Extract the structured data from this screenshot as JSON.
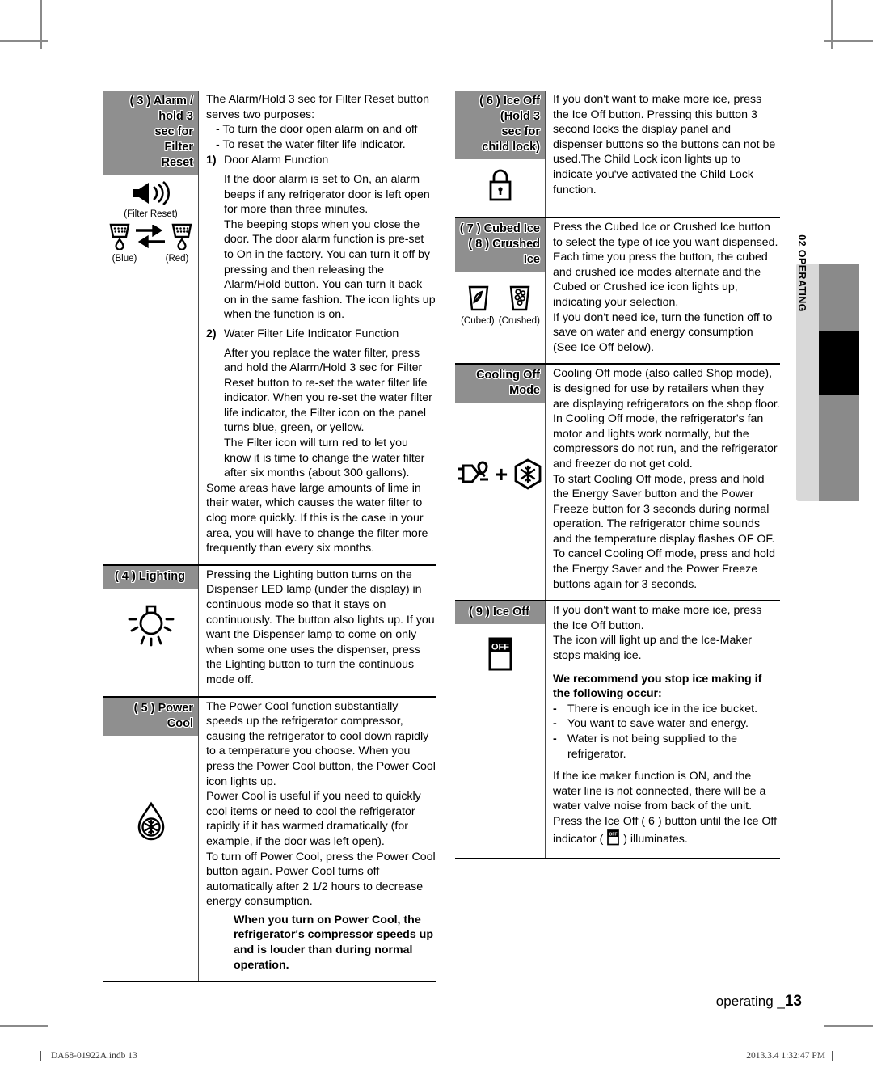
{
  "page": {
    "footer_label": "operating _",
    "page_number": "13",
    "indb_file": "DA68-01922A.indb   13",
    "print_stamp": "2013.3.4   1:32:47 PM",
    "side_tab_label": "02  OPERATING"
  },
  "colors": {
    "header_gray": "#8f8f8f",
    "side_tab_gray": "#d8d8d8",
    "side_bar_gray": "#8a8a8a",
    "side_bar_active": "#000000"
  },
  "left_column": {
    "sections": [
      {
        "id": "alarm-filter-reset",
        "title": "( 3 ) Alarm /\nhold 3\nsec for\nFilter\nReset",
        "icons": {
          "speaker_label": "(Filter Reset)",
          "blue_label": "(Blue)",
          "red_label": "(Red)"
        },
        "body": {
          "intro": "The Alarm/Hold 3 sec for Filter Reset button serves two purposes:",
          "dash1": "- To turn the door open alarm on and off",
          "dash2": "- To reset the water filter life indicator.",
          "item1_num": "1)",
          "item1_title": "Door Alarm Function",
          "item1_p1": "If the door alarm is set to On, an alarm beeps if any refrigerator door is left open for more than three minutes.",
          "item1_p2": "The beeping stops when you close the door. The door alarm function is pre-set to On in the factory. You can turn it off by pressing and then releasing the Alarm/Hold button. You can turn it back on in the same fashion. The icon lights up when the function is on.",
          "item2_num": "2)",
          "item2_title": "Water Filter Life Indicator Function",
          "item2_p1": "After you replace the water filter, press and hold the Alarm/Hold 3 sec for Filter Reset button to re-set the water filter life indicator. When you re-set the water filter life indicator, the Filter icon on the panel turns blue, green, or yellow.",
          "item2_p2": "The Filter icon will turn red to let you know it is time to change the water filter after six months (about 300 gallons).",
          "outro": "Some areas have large amounts of lime in their water, which causes the water filter to clog more quickly. If this is the case in your area, you will have to change the filter more frequently than every six months."
        }
      },
      {
        "id": "lighting",
        "title": "( 4 ) Lighting",
        "body": {
          "p1": "Pressing the Lighting button turns on the Dispenser LED lamp (under the display) in continuous mode so that it stays on continuously. The button also lights up. If you want the Dispenser lamp to come on only when some one uses the dispenser, press the Lighting button to turn the continuous mode off."
        }
      },
      {
        "id": "power-cool",
        "title": "( 5 ) Power\nCool",
        "body": {
          "p1": "The Power Cool function substantially speeds up the refrigerator compressor, causing the refrigerator to cool down rapidly to a temperature you choose. When you press the Power Cool button, the Power Cool icon lights up.",
          "p2": "Power Cool is useful if you need to quickly cool items or need to cool the refrigerator rapidly if it has warmed dramatically (for example, if the door was left open).",
          "p3": "To turn off Power Cool, press the Power Cool button again. Power Cool turns off automatically after 2 1/2 hours to decrease energy consumption.",
          "note": "When you turn on Power Cool, the refrigerator's compressor speeds up and is louder than during normal operation."
        }
      }
    ]
  },
  "right_column": {
    "sections": [
      {
        "id": "ice-off-child-lock",
        "title": "( 6 ) Ice Off\n(Hold 3\nsec for\nchild lock)",
        "body": {
          "p1": "If you don't want to make more ice, press the Ice Off button.  Pressing this button 3 second locks the display panel and dispenser buttons so the buttons can not be used.The Child Lock icon lights up to indicate you've activated the Child Lock function."
        }
      },
      {
        "id": "cubed-crushed-ice",
        "title": "( 7 ) Cubed Ice\n( 8 ) Crushed\nIce",
        "icons": {
          "cubed_label": "(Cubed)",
          "crushed_label": "(Crushed)"
        },
        "body": {
          "p1": "Press the Cubed Ice or Crushed Ice button to select the type of ice you want dispensed. Each time you press the button, the cubed and crushed ice modes alternate and the Cubed or Crushed ice icon lights up, indicating your selection.",
          "p2": "If you don't need ice, turn the function off to save on water and energy consumption (See Ice Off below)."
        }
      },
      {
        "id": "cooling-off-mode",
        "title": "Cooling Off\nMode",
        "body": {
          "p1": "Cooling Off mode (also called Shop mode), is designed for use by retailers when they are displaying refrigerators on the shop floor. In Cooling Off mode, the refrigerator's fan motor and lights work normally, but the compressors do not run, and the refrigerator and freezer do not get cold.",
          "p2": "To start Cooling Off mode, press and hold the Energy Saver button and the Power Freeze button for 3 seconds during normal operation. The refrigerator chime sounds and the temperature display flashes OF OF.",
          "p3": "To cancel Cooling Off mode, press and hold the Energy Saver and the Power Freeze buttons again for 3 seconds."
        }
      },
      {
        "id": "ice-off",
        "title": "( 9 ) Ice Off",
        "icons": {
          "off_text": "OFF"
        },
        "body": {
          "p1": "If you don't want to make more ice, press the Ice Off button.",
          "p2": "The icon will light up and the Ice-Maker stops making ice.",
          "bold_head": "We recommend you stop ice making if the following occur:",
          "b1": "There is enough ice in the ice bucket.",
          "b2": "You want to save water and energy.",
          "b3": "Water is not being supplied to the refrigerator.",
          "p3_a": "If the ice maker function is ON, and the water line is not connected, there will be a  water valve noise from back of the unit. Press the Ice Off ( 6 ) button until the Ice Off indicator (",
          "p3_b": ") illuminates."
        }
      }
    ]
  }
}
